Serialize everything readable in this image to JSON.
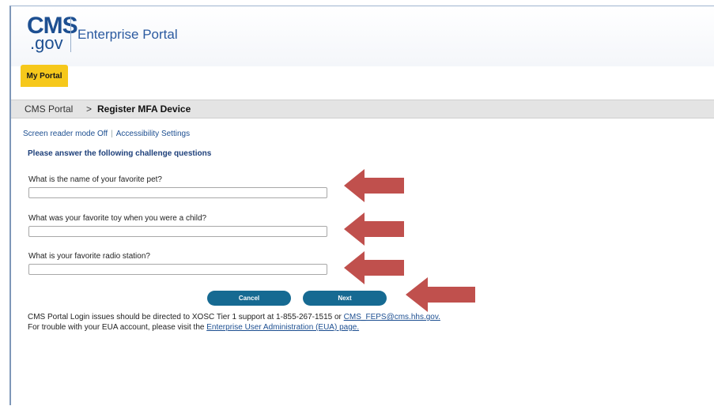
{
  "header": {
    "logo_top": "CMS",
    "logo_bottom": ".gov",
    "portal_name": "Enterprise Portal",
    "my_portal_tab": "My Portal"
  },
  "breadcrumb": {
    "home": "CMS Portal",
    "separator": ">",
    "current": "Register MFA Device"
  },
  "accessibility": {
    "screen_reader": "Screen reader mode Off",
    "separator": "|",
    "settings": "Accessibility Settings"
  },
  "form": {
    "title": "Please answer the following challenge questions",
    "questions": [
      {
        "label": "What is the name of your favorite pet?",
        "value": ""
      },
      {
        "label": "What was your favorite toy when you were a child?",
        "value": ""
      },
      {
        "label": "What is your favorite radio station?",
        "value": ""
      }
    ],
    "cancel_label": "Cancel",
    "next_label": "Next"
  },
  "footer": {
    "line1_text": "CMS Portal Login issues should be directed to XOSC Tier 1 support at 1-855-267-1515 or ",
    "line1_link": "CMS_FEPS@cms.hhs.gov.",
    "line2_text": "For trouble with your EUA account, please visit the ",
    "line2_link": "Enterprise User Administration (EUA) page."
  },
  "colors": {
    "brand_blue": "#1d4f91",
    "tab_yellow": "#f6c81b",
    "button_teal": "#166a92",
    "annotation_arrow": "#c0504d"
  },
  "icons": {
    "annotation": "left-arrow-icon"
  }
}
